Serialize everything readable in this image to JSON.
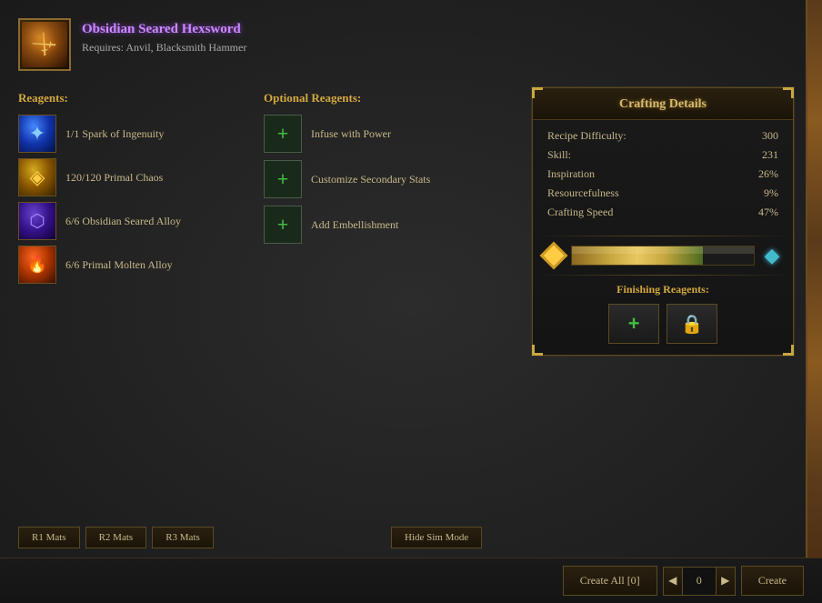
{
  "item": {
    "name": "Obsidian Seared Hexsword",
    "requires_label": "Requires:",
    "requires_value": "Anvil, Blacksmith Hammer"
  },
  "reagents": {
    "label": "Reagents:",
    "items": [
      {
        "qty": "1/1",
        "name": "Spark of Ingenuity",
        "type": "spark"
      },
      {
        "qty": "120/120",
        "name": "Primal Chaos",
        "type": "chaos"
      },
      {
        "qty": "6/6",
        "name": "Obsidian Seared Alloy",
        "type": "obsidian"
      },
      {
        "qty": "6/6",
        "name": "Primal Molten Alloy",
        "type": "molten"
      }
    ]
  },
  "optional_reagents": {
    "label": "Optional Reagents:",
    "items": [
      {
        "label": "Infuse with Power"
      },
      {
        "label": "Customize Secondary Stats"
      },
      {
        "label": "Add Embellishment"
      }
    ]
  },
  "crafting_details": {
    "title": "Crafting Details",
    "stats": [
      {
        "label": "Recipe Difficulty:",
        "value": "300"
      },
      {
        "label": "Skill:",
        "value": "231"
      },
      {
        "label": "Inspiration",
        "value": "26%"
      },
      {
        "label": "Resourcefulness",
        "value": "9%"
      },
      {
        "label": "Crafting Speed",
        "value": "47%"
      }
    ],
    "finishing_reagents_label": "Finishing Reagents:"
  },
  "rank_buttons": {
    "r1": "R1 Mats",
    "r2": "R2 Mats",
    "r3": "R3 Mats"
  },
  "toolbar": {
    "hide_sim": "Hide Sim Mode",
    "create_all": "Create All [0]",
    "create": "Create"
  }
}
